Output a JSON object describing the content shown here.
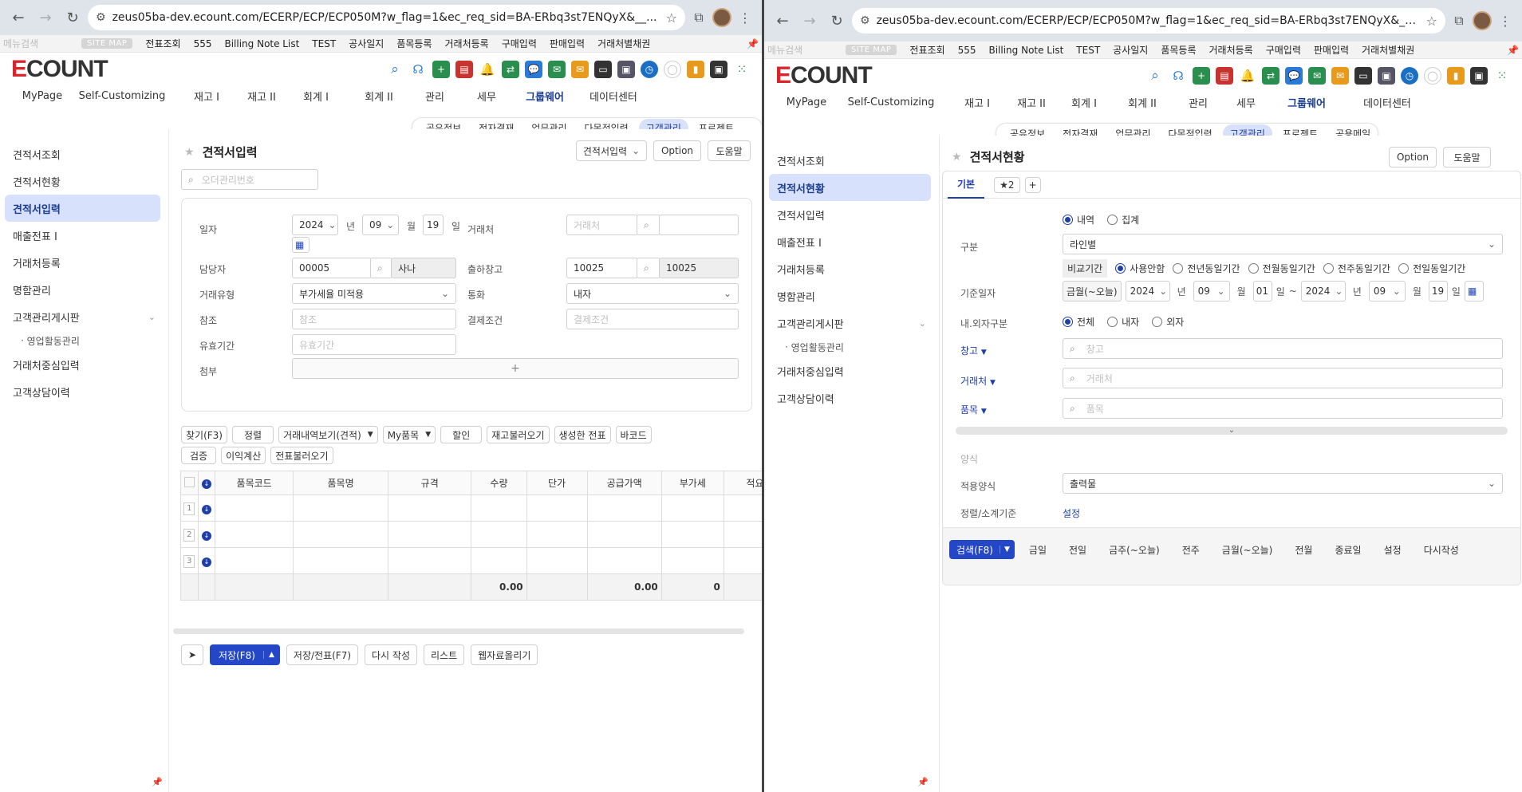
{
  "browser": {
    "url": "zeus05ba-dev.ecount.com/ECERP/ECP/ECP050M?w_flag=1&ec_req_sid=BA-ERbq3st7ENQyX&__..."
  },
  "topmenu": {
    "search_placeholder": "메뉴검색",
    "sitemap": "SITE MAP",
    "items": [
      "전표조회",
      "555",
      "Billing Note List",
      "TEST",
      "공사일지",
      "품목등록",
      "거래처등록",
      "구매입력",
      "판매입력",
      "거래처별채권"
    ]
  },
  "logo": "ECOUNT",
  "mainmenu": [
    "MyPage",
    "Self-Customizing",
    "재고 I",
    "재고 II",
    "회계 I",
    "회계 II",
    "관리",
    "세무",
    "그룹웨어",
    "데이터센터"
  ],
  "submenu": {
    "left": [
      "공유정보",
      "전자결재",
      "업무관리",
      "다목적입력",
      "고객관리",
      "프로젝트"
    ],
    "right": [
      "공유정보",
      "전자결재",
      "업무관리",
      "다목적입력",
      "고객관리",
      "프로젝트",
      "공용메일"
    ],
    "active": "고객관리"
  },
  "sidebar": {
    "items": [
      "견적서조회",
      "견적서현황",
      "견적서입력",
      "매출전표 I",
      "거래처등록",
      "명함관리",
      "고객관리게시판"
    ],
    "sub": "영업활동관리",
    "items2": [
      "거래처중심입력",
      "고객상담이력"
    ]
  },
  "left": {
    "title": "견적서입력",
    "btn_form": "견적서입력",
    "btn_option": "Option",
    "btn_help": "도움말",
    "order_placeholder": "오더관리번호",
    "labels": {
      "date": "일자",
      "manager": "담당자",
      "trade_type": "거래유형",
      "ref": "참조",
      "valid": "유효기간",
      "attach": "첨부",
      "customer": "거래처",
      "warehouse": "출하창고",
      "currency": "통화",
      "payment": "결제조건"
    },
    "date": {
      "year": "2024",
      "y": "년",
      "month": "09",
      "m": "월",
      "day": "19",
      "d": "일"
    },
    "manager_code": "00005",
    "manager_name": "사나",
    "trade_type": "부가세율 미적용",
    "ref_ph": "참조",
    "valid_ph": "유효기간",
    "customer_ph": "거래처",
    "warehouse_code": "10025",
    "warehouse_name": "10025",
    "currency": "내자",
    "payment_ph": "결제조건",
    "toolbar1": [
      "찾기(F3)",
      "정렬",
      "거래내역보기(견적)",
      "My품목",
      "할인",
      "재고불러오기",
      "생성한 전표",
      "바코드"
    ],
    "toolbar2": [
      "검증",
      "이익계산",
      "전표불러오기"
    ],
    "columns": [
      "품목코드",
      "품목명",
      "규격",
      "수량",
      "단가",
      "공급가액",
      "부가세",
      "적요"
    ],
    "rows": [
      "1",
      "2",
      "3"
    ],
    "totals": {
      "qty": "0.00",
      "supply": "0.00",
      "vat": "0"
    },
    "footer": [
      "저장(F8)",
      "저장/전표(F7)",
      "다시 작성",
      "리스트",
      "웹자료올리기"
    ]
  },
  "right": {
    "title": "견적서현황",
    "btn_option": "Option",
    "btn_help": "도움말",
    "tab_basic": "기본",
    "tab_star": "★2",
    "tab_add": "+",
    "labels": {
      "type": "구분",
      "base_date": "기준일자",
      "inout": "내.외자구분",
      "warehouse": "창고",
      "customer": "거래처",
      "item": "품목",
      "form_section": "양식",
      "applied_form": "적용양식",
      "sort": "정렬/소계기준"
    },
    "radio_detail": "내역",
    "radio_sum": "집계",
    "type_value": "라인별",
    "compare_label": "비교기간",
    "compare_opts": [
      "사용안함",
      "전년동일기간",
      "전월동일기간",
      "전주동일기간",
      "전일동일기간"
    ],
    "date_preset": "금월(~오늘)",
    "date_from": {
      "year": "2024",
      "month": "09",
      "day": "01"
    },
    "date_to": {
      "year": "2024",
      "month": "09",
      "day": "19"
    },
    "unit": {
      "y": "년",
      "m": "월",
      "d": "일",
      "tilde": "~"
    },
    "inout_opts": [
      "전체",
      "내자",
      "외자"
    ],
    "warehouse_ph": "창고",
    "customer_ph": "거래처",
    "item_ph": "품목",
    "applied_form": "출력물",
    "sort_link": "설정",
    "search_btn": "검색(F8)",
    "quick": [
      "금일",
      "전일",
      "금주(~오늘)",
      "전주",
      "금월(~오늘)",
      "전월",
      "종료일",
      "설정",
      "다시작성"
    ]
  }
}
